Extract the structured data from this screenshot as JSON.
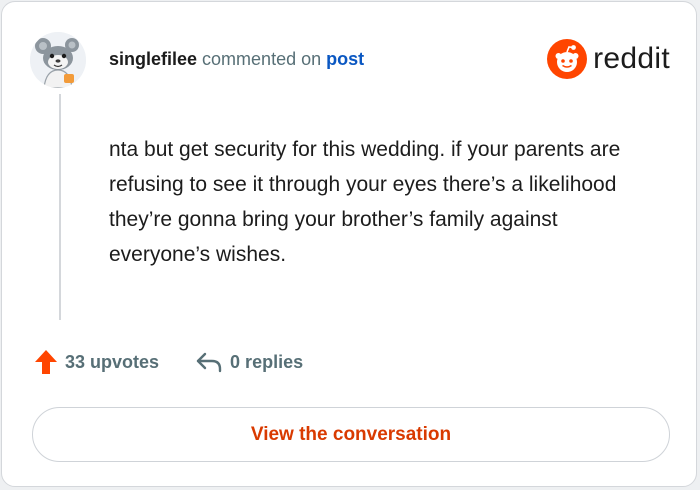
{
  "header": {
    "username": "singlefilee",
    "action_text": "commented on",
    "target_link": "post"
  },
  "brand": {
    "name": "reddit",
    "icon": "reddit-logo-icon",
    "accent_color": "#ff4500"
  },
  "comment": {
    "text": "nta but get security for this wedding. if your parents are refusing to see it through your eyes there’s a likelihood they’re gonna bring your brother’s family against everyone’s wishes."
  },
  "actions": {
    "upvotes_label": "33 upvotes",
    "upvote_icon": "upvote-arrow-icon",
    "replies_label": "0 replies",
    "reply_icon": "reply-arrow-icon"
  },
  "cta": {
    "label": "View the conversation"
  },
  "colors": {
    "upvote": "#ff4500",
    "link": "#0a57c2",
    "cta_text": "#d93a00",
    "muted": "#576f76"
  }
}
